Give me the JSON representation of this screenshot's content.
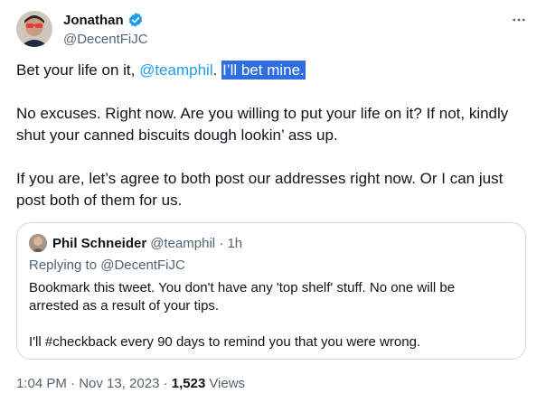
{
  "author": {
    "display_name": "Jonathan",
    "handle": "@DecentFiJC"
  },
  "tweet": {
    "line1_prefix": "Bet your life on it, ",
    "line1_mention": "@teamphil",
    "line1_dot": ".",
    "line1_space": " ",
    "line1_highlight": "I’ll bet mine.",
    "paragraph2": "No excuses. Right now. Are you willing to put your life on it? If not, kindly shut your canned biscuits dough lookin’ ass up.",
    "paragraph3": "If you are, let’s agree to both post our addresses right now. Or I can just post both of them for us."
  },
  "quote": {
    "display_name": "Phil Schneider",
    "meta": "@teamphil · 1h",
    "replying_to": "Replying to @DecentFiJC",
    "paragraph1": "Bookmark this tweet. You don't have any 'top shelf' stuff. No one will be arrested as a result of your tips.",
    "paragraph2": "I'll #checkback every 90 days to remind you that you were wrong."
  },
  "footer": {
    "timestamp": "1:04 PM · Nov 13, 2023 · ",
    "views_count": "1,523",
    "views_label": "Views"
  },
  "icons": {
    "verified": "verified-badge-icon",
    "more": "more-options-icon"
  },
  "colors": {
    "accent": "#1d9bf0",
    "highlight": "#2e6ee0",
    "muted": "#536471",
    "text": "#0f1419",
    "border": "#cfd9de"
  }
}
